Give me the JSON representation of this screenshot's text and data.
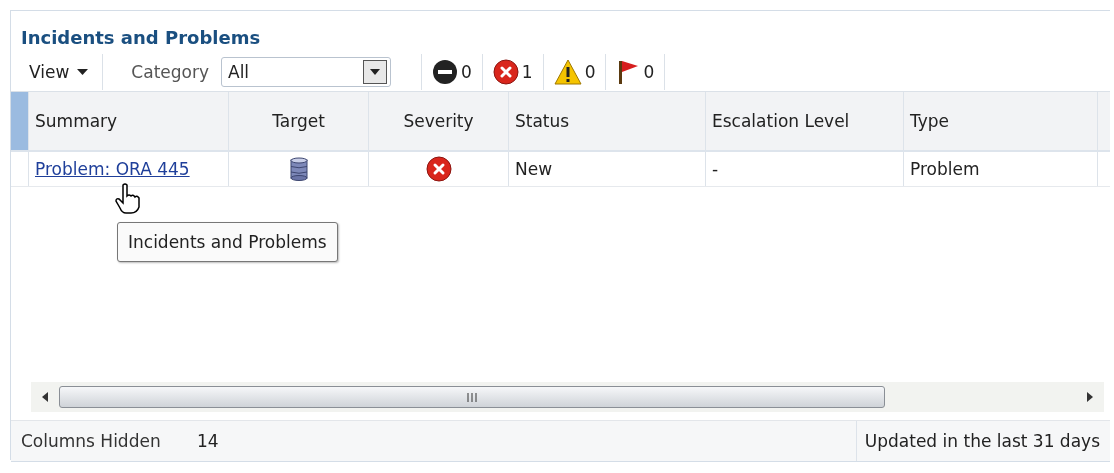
{
  "panel": {
    "title": "Incidents and Problems"
  },
  "toolbar": {
    "view_menu": "View",
    "category_label": "Category",
    "category_value": "All",
    "counts": [
      {
        "kind": "fatal",
        "count": "0"
      },
      {
        "kind": "critical",
        "count": "1"
      },
      {
        "kind": "warning",
        "count": "0"
      },
      {
        "kind": "escalated",
        "count": "0"
      }
    ]
  },
  "table": {
    "columns": [
      "Summary",
      "Target",
      "Severity",
      "Status",
      "Escalation Level",
      "Type"
    ],
    "rows": [
      {
        "summary": "Problem: ORA 445",
        "target": {
          "kind": "database"
        },
        "severity": {
          "kind": "critical"
        },
        "status": "New",
        "escalation": "-",
        "type": "Problem"
      }
    ]
  },
  "tooltip": "Incidents and Problems",
  "footer": {
    "columns_hidden_label": "Columns Hidden",
    "columns_hidden": "14",
    "range": "Updated in the last 31 days"
  }
}
